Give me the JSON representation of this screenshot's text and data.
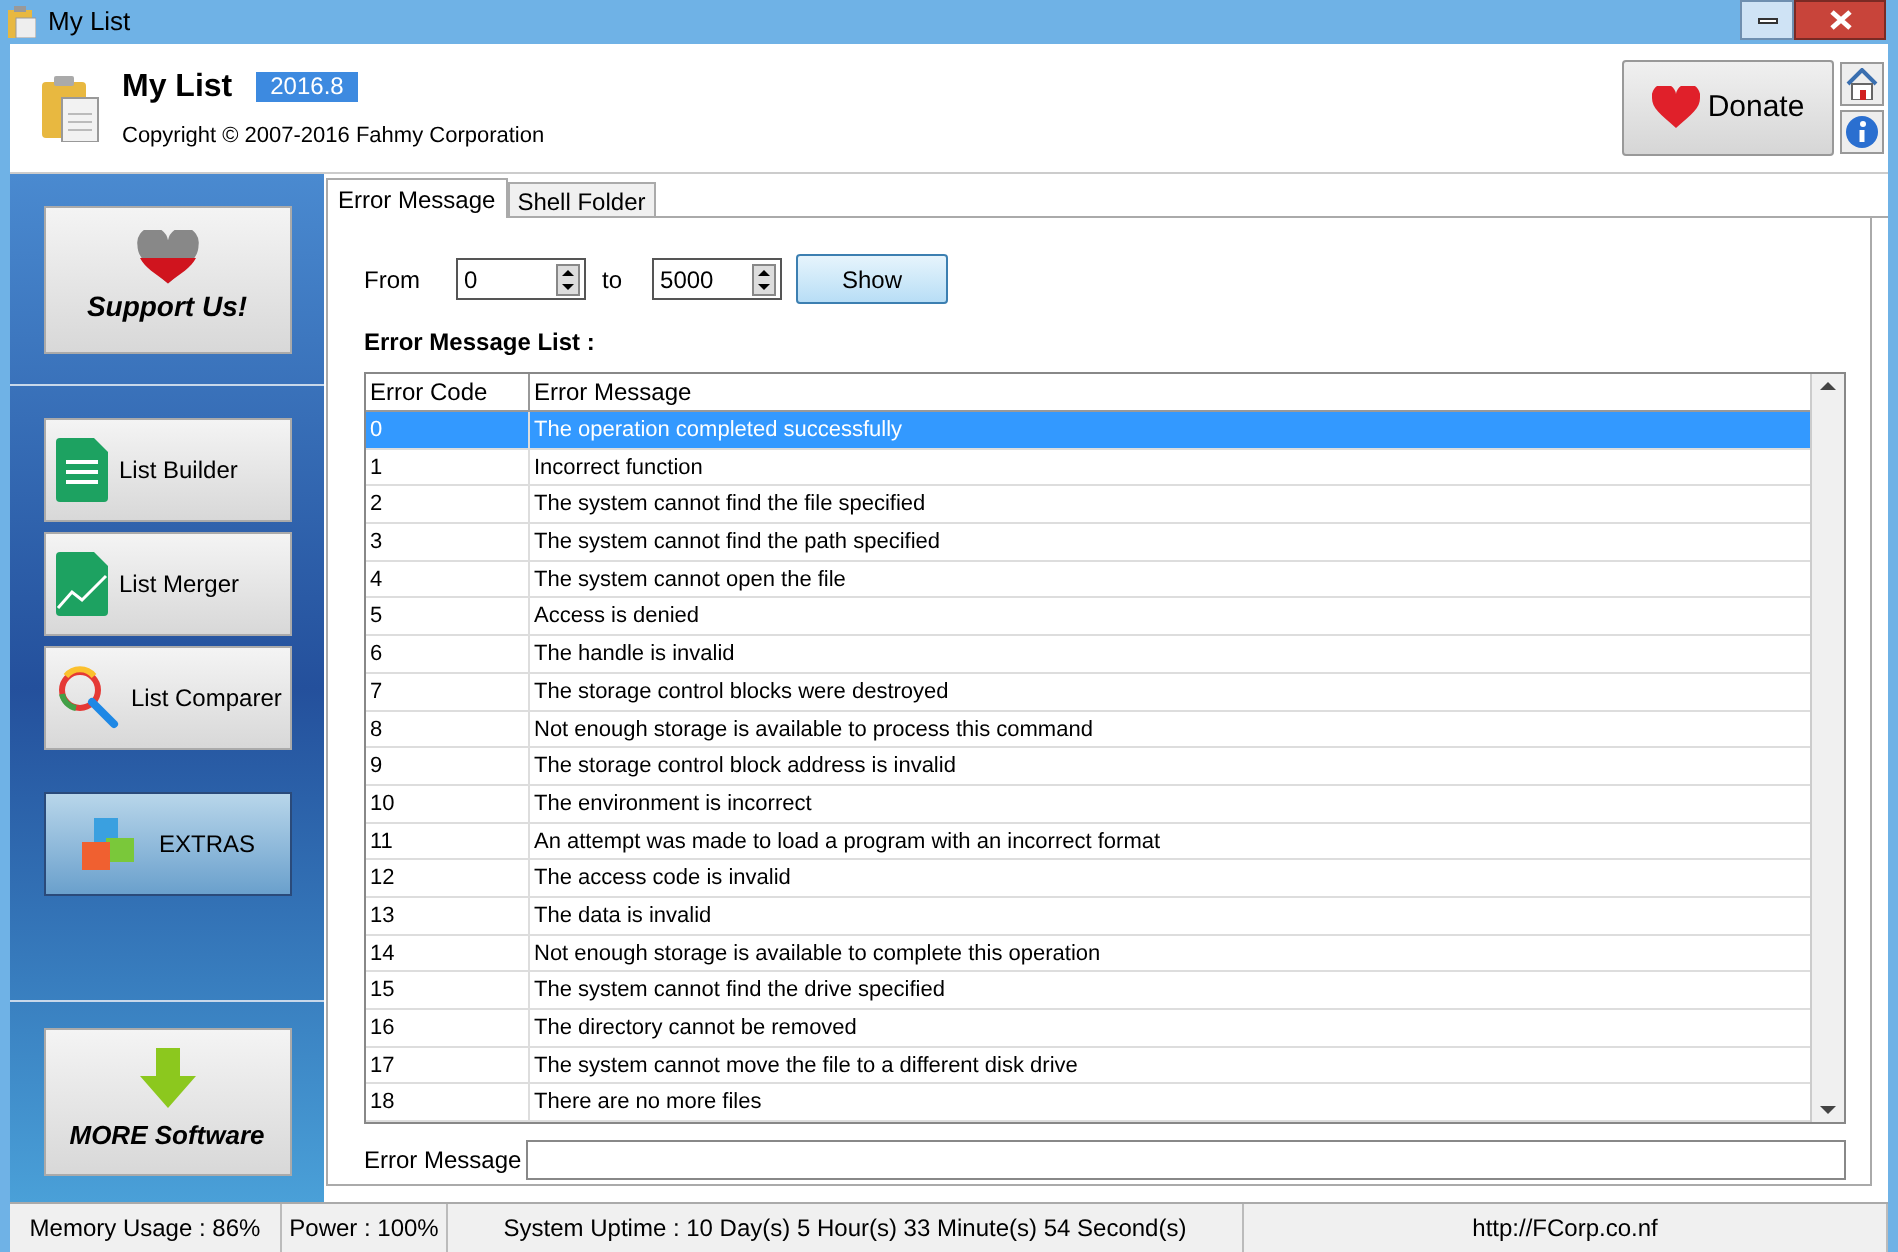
{
  "window": {
    "title": "My List"
  },
  "header": {
    "app_name": "My List",
    "version": "2016.8",
    "copyright": "Copyright © 2007-2016 Fahmy Corporation",
    "donate": "Donate"
  },
  "sidebar": {
    "support": "Support Us!",
    "items": [
      {
        "label": "List Builder",
        "kind": "builder"
      },
      {
        "label": "List Merger",
        "kind": "merger"
      },
      {
        "label": "List Comparer",
        "kind": "comparer"
      }
    ],
    "extras": "EXTRAS",
    "more": "MORE Software"
  },
  "tabs": [
    {
      "label": "Error Message",
      "selected": true
    },
    {
      "label": "Shell Folder",
      "selected": false
    }
  ],
  "range": {
    "from_label": "From",
    "from": "0",
    "to_label": "to",
    "to": "5000",
    "show": "Show"
  },
  "list_title": "Error Message List :",
  "table": {
    "columns": [
      "Error Code",
      "Error Message"
    ],
    "rows": [
      {
        "code": "0",
        "message": "The operation completed successfully",
        "selected": true
      },
      {
        "code": "1",
        "message": "Incorrect function",
        "selected": false
      },
      {
        "code": "2",
        "message": "The system cannot find the file specified",
        "selected": false
      },
      {
        "code": "3",
        "message": "The system cannot find the path specified",
        "selected": false
      },
      {
        "code": "4",
        "message": "The system cannot open the file",
        "selected": false
      },
      {
        "code": "5",
        "message": "Access is denied",
        "selected": false
      },
      {
        "code": "6",
        "message": "The handle is invalid",
        "selected": false
      },
      {
        "code": "7",
        "message": "The storage control blocks were destroyed",
        "selected": false
      },
      {
        "code": "8",
        "message": "Not enough storage is available to process this command",
        "selected": false
      },
      {
        "code": "9",
        "message": "The storage control block address is invalid",
        "selected": false
      },
      {
        "code": "10",
        "message": "The environment is incorrect",
        "selected": false
      },
      {
        "code": "11",
        "message": "An attempt was made to load a program with an incorrect format",
        "selected": false
      },
      {
        "code": "12",
        "message": "The access code is invalid",
        "selected": false
      },
      {
        "code": "13",
        "message": "The data is invalid",
        "selected": false
      },
      {
        "code": "14",
        "message": "Not enough storage is available to complete this operation",
        "selected": false
      },
      {
        "code": "15",
        "message": "The system cannot find the drive specified",
        "selected": false
      },
      {
        "code": "16",
        "message": "The directory cannot be removed",
        "selected": false
      },
      {
        "code": "17",
        "message": "The system cannot move the file to a different disk drive",
        "selected": false
      },
      {
        "code": "18",
        "message": "There are no more files",
        "selected": false
      }
    ]
  },
  "error_field": {
    "label": "Error Message"
  },
  "status_bar": [
    "Memory Usage : 86%",
    "Power : 100%",
    "System Uptime : 10 Day(s) 5 Hour(s) 33 Minute(s) 54 Second(s)",
    "http://FCorp.co.nf"
  ]
}
